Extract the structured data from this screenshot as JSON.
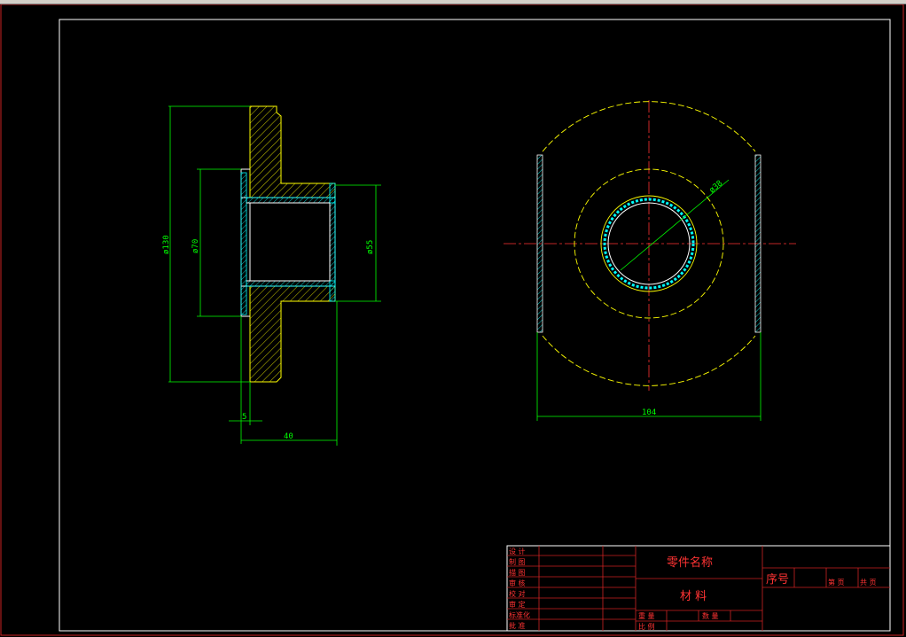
{
  "dimensions": {
    "d130": "ø130",
    "d70": "ø70",
    "d55": "ø55",
    "w5": "5",
    "w40": "40",
    "d38": "ø38",
    "w104": "104"
  },
  "title_block": {
    "part_name": "零件名称",
    "material": "材 料",
    "seq_no": "序号",
    "row_labels": [
      "设 计",
      "制 图",
      "描 图",
      "审 核",
      "校 对",
      "审 定",
      "标准化",
      "批 准"
    ],
    "sheet_total": "共 页",
    "sheet_no": "第 页",
    "weight": "重 量",
    "ratio": "比 例",
    "qty": "数 量"
  }
}
